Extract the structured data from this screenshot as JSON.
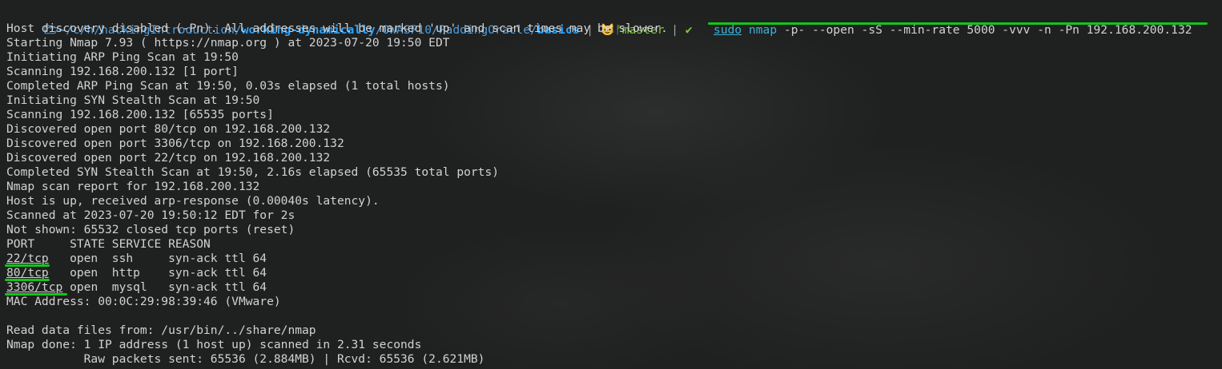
{
  "prompt": {
    "dir_icon": "folder-open-icon",
    "home": "~",
    "path_segments": [
      "/c",
      "/h",
      "/hackingIntroduction",
      "/"
    ],
    "path_bold": "working-dynamically",
    "path_tail": "/OWASP10/PaddingOracle/",
    "current_dir": "basics",
    "sep1": " | ",
    "git_icon": "github-cat-icon",
    "branch_icon": "branch-icon",
    "branch": "master",
    "sep2": " | ",
    "status": "✔",
    "cmd_sudo": "sudo",
    "cmd_name": "nmap",
    "cmd_args": " -p- --open -sS --min-rate 5000 -vvv -n -Pn 192.168.200.132"
  },
  "output": {
    "lines": [
      "Host discovery disabled (-Pn). All addresses will be marked 'up' and scan times may be slower.",
      "Starting Nmap 7.93 ( https://nmap.org ) at 2023-07-20 19:50 EDT",
      "Initiating ARP Ping Scan at 19:50",
      "Scanning 192.168.200.132 [1 port]",
      "Completed ARP Ping Scan at 19:50, 0.03s elapsed (1 total hosts)",
      "Initiating SYN Stealth Scan at 19:50",
      "Scanning 192.168.200.132 [65535 ports]",
      "Discovered open port 80/tcp on 192.168.200.132",
      "Discovered open port 3306/tcp on 192.168.200.132",
      "Discovered open port 22/tcp on 192.168.200.132",
      "Completed SYN Stealth Scan at 19:50, 2.16s elapsed (65535 total ports)",
      "Nmap scan report for 192.168.200.132",
      "Host is up, received arp-response (0.00040s latency).",
      "Scanned at 2023-07-20 19:50:12 EDT for 2s",
      "Not shown: 65532 closed tcp ports (reset)",
      "PORT     STATE SERVICE REASON"
    ],
    "ports": [
      {
        "port": "22/tcp",
        "rest": "   open  ssh     syn-ack ttl 64"
      },
      {
        "port": "80/tcp",
        "rest": "   open  http    syn-ack ttl 64"
      },
      {
        "port": "3306/tcp",
        "rest": " open  mysql   syn-ack ttl 64"
      }
    ],
    "mac": "MAC Address: 00:0C:29:98:39:46 (VMware)",
    "blank": "",
    "read_data": "Read data files from: /usr/bin/../share/nmap",
    "done": "Nmap done: 1 IP address (1 host up) scanned in 2.31 seconds",
    "raw": "           Raw packets sent: 65536 (2.884MB) | Rcvd: 65536 (2.621MB)"
  },
  "colors": {
    "background": "#1f2020",
    "text": "#d2d2d2",
    "path": "#4f9fe0",
    "git": "#7ecb3f",
    "command": "#3ab2d8",
    "highlight": "#13c51a"
  }
}
